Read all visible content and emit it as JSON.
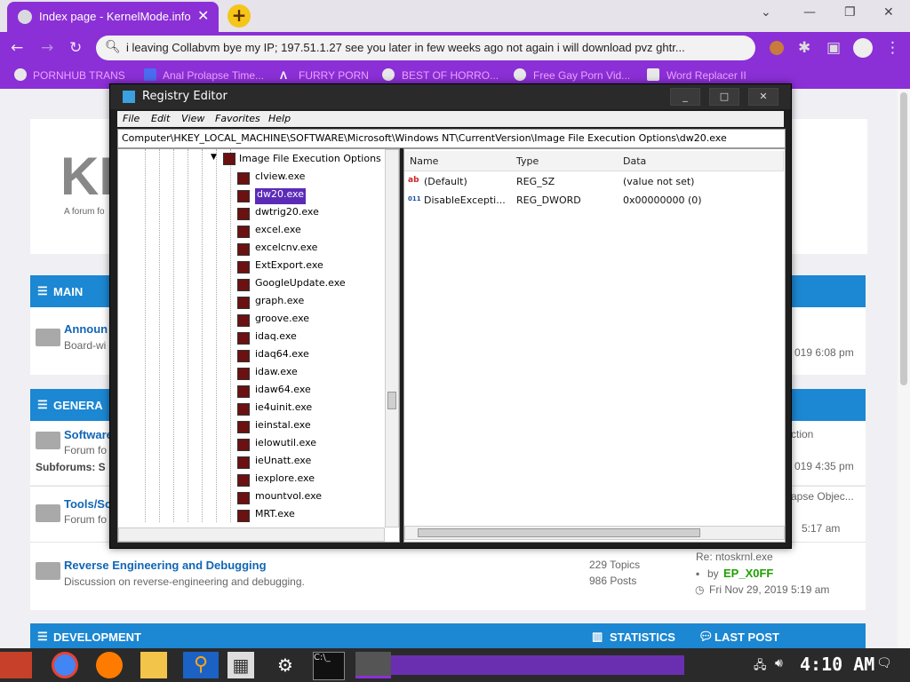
{
  "browser": {
    "tab_title": "Index page - KernelMode.info",
    "tab_close": "✕",
    "new_tab": "+",
    "address": "i leaving Collabvm bye my IP; 197.51.1.27 see you later in few weeks ago not again i will download pvz ghtr...",
    "bookmarks": [
      "PORNHUB TRANS",
      "Anal Prolapse Time...",
      "FURRY PORN",
      "BEST OF HORRO...",
      "Free Gay Porn Vid...",
      "Word Replacer II"
    ],
    "accent": "#8b2fd6"
  },
  "page": {
    "logo": "KE",
    "tagline": "A forum fo",
    "sections": {
      "main": "MAIN",
      "general": "GENERA",
      "development": "DEVELOPMENT",
      "statistics": "STATISTICS",
      "last_post": "LAST POST"
    },
    "forums": [
      {
        "title": "Announ",
        "desc": "Board-wi",
        "last": "019 6:08 pm"
      },
      {
        "title": "Software",
        "desc": "Forum fo",
        "sub": "Subforums: S",
        "last_a": "ction",
        "last_b": "019 4:35 pm"
      },
      {
        "title": "Tools/Sc",
        "desc": "Forum fo",
        "last_a": "apse Objec...",
        "last_b": "5:17 am"
      },
      {
        "title": "Reverse Engineering and Debugging",
        "desc": "Discussion on reverse-engineering and debugging.",
        "topics": "229 Topics",
        "posts": "986 Posts",
        "last_title": "Re: ntoskrnl.exe",
        "last_by": "by",
        "last_user": "EP_X0FF",
        "last_date": "Fri Nov 29, 2019 5:19 am"
      }
    ]
  },
  "regedit": {
    "title": "Registry Editor",
    "menu": [
      "File",
      "Edit",
      "View",
      "Favorites",
      "Help"
    ],
    "path": "Computer\\HKEY_LOCAL_MACHINE\\SOFTWARE\\Microsoft\\Windows NT\\CurrentVersion\\Image File Execution Options\\dw20.exe",
    "tree_parent": "Image File Execution Options",
    "tree_items": [
      "clview.exe",
      "dw20.exe",
      "dwtrig20.exe",
      "excel.exe",
      "excelcnv.exe",
      "ExtExport.exe",
      "GoogleUpdate.exe",
      "graph.exe",
      "groove.exe",
      "idaq.exe",
      "idaq64.exe",
      "idaw.exe",
      "idaw64.exe",
      "ie4uinit.exe",
      "ieinstal.exe",
      "ielowutil.exe",
      "ieUnatt.exe",
      "iexplore.exe",
      "mountvol.exe",
      "MRT.exe"
    ],
    "selected": "dw20.exe",
    "columns": [
      "Name",
      "Type",
      "Data"
    ],
    "values": [
      {
        "name": "(Default)",
        "type": "REG_SZ",
        "data": "(value not set)",
        "icon": "ab"
      },
      {
        "name": "DisableExcepti...",
        "type": "REG_DWORD",
        "data": "0x00000000 (0)",
        "icon": "011"
      }
    ]
  },
  "taskbar": {
    "clock": "4:10 AM"
  }
}
